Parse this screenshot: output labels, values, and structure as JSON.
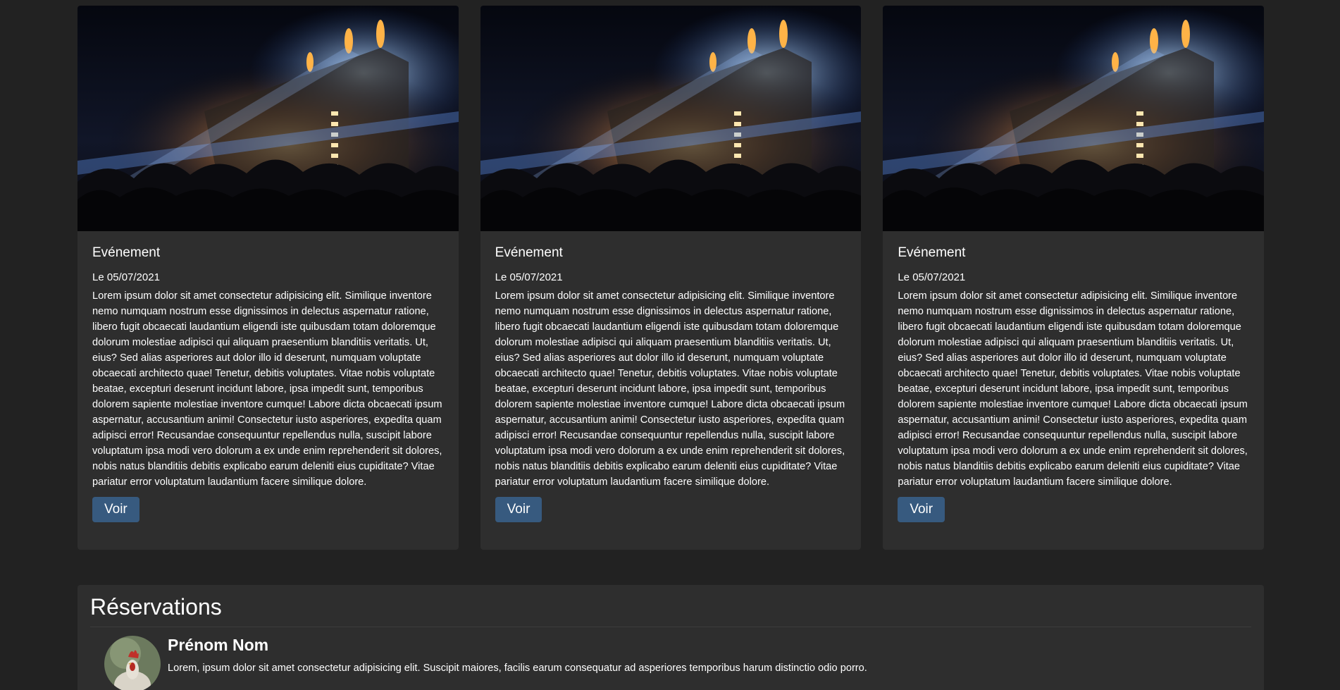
{
  "events": [
    {
      "title": "Evénement",
      "date": "Le 05/07/2021",
      "text": "Lorem ipsum dolor sit amet consectetur adipisicing elit. Similique inventore nemo numquam nostrum esse dignissimos in delectus aspernatur ratione, libero fugit obcaecati laudantium eligendi iste quibusdam totam doloremque dolorum molestiae adipisci qui aliquam praesentium blanditiis veritatis. Ut, eius? Sed alias asperiores aut dolor illo id deserunt, numquam voluptate obcaecati architecto quae! Tenetur, debitis voluptates. Vitae nobis voluptate beatae, excepturi deserunt incidunt labore, ipsa impedit sunt, temporibus dolorem sapiente molestiae inventore cumque! Labore dicta obcaecati ipsum aspernatur, accusantium animi! Consectetur iusto asperiores, expedita quam adipisci error! Recusandae consequuntur repellendus nulla, suscipit labore voluptatum ipsa modi vero dolorum a ex unde enim reprehenderit sit dolores, nobis natus blanditiis debitis explicabo earum deleniti eius cupiditate? Vitae pariatur error voluptatum laudantium facere similique dolore.",
      "button": "Voir"
    },
    {
      "title": "Evénement",
      "date": "Le 05/07/2021",
      "text": "Lorem ipsum dolor sit amet consectetur adipisicing elit. Similique inventore nemo numquam nostrum esse dignissimos in delectus aspernatur ratione, libero fugit obcaecati laudantium eligendi iste quibusdam totam doloremque dolorum molestiae adipisci qui aliquam praesentium blanditiis veritatis. Ut, eius? Sed alias asperiores aut dolor illo id deserunt, numquam voluptate obcaecati architecto quae! Tenetur, debitis voluptates. Vitae nobis voluptate beatae, excepturi deserunt incidunt labore, ipsa impedit sunt, temporibus dolorem sapiente molestiae inventore cumque! Labore dicta obcaecati ipsum aspernatur, accusantium animi! Consectetur iusto asperiores, expedita quam adipisci error! Recusandae consequuntur repellendus nulla, suscipit labore voluptatum ipsa modi vero dolorum a ex unde enim reprehenderit sit dolores, nobis natus blanditiis debitis explicabo earum deleniti eius cupiditate? Vitae pariatur error voluptatum laudantium facere similique dolore.",
      "button": "Voir"
    },
    {
      "title": "Evénement",
      "date": "Le 05/07/2021",
      "text": "Lorem ipsum dolor sit amet consectetur adipisicing elit. Similique inventore nemo numquam nostrum esse dignissimos in delectus aspernatur ratione, libero fugit obcaecati laudantium eligendi iste quibusdam totam doloremque dolorum molestiae adipisci qui aliquam praesentium blanditiis veritatis. Ut, eius? Sed alias asperiores aut dolor illo id deserunt, numquam voluptate obcaecati architecto quae! Tenetur, debitis voluptates. Vitae nobis voluptate beatae, excepturi deserunt incidunt labore, ipsa impedit sunt, temporibus dolorem sapiente molestiae inventore cumque! Labore dicta obcaecati ipsum aspernatur, accusantium animi! Consectetur iusto asperiores, expedita quam adipisci error! Recusandae consequuntur repellendus nulla, suscipit labore voluptatum ipsa modi vero dolorum a ex unde enim reprehenderit sit dolores, nobis natus blanditiis debitis explicabo earum deleniti eius cupiditate? Vitae pariatur error voluptatum laudantium facere similique dolore.",
      "button": "Voir"
    }
  ],
  "reservations": {
    "title": "Réservations",
    "items": [
      {
        "name": "Prénom Nom",
        "text": "Lorem, ipsum dolor sit amet consectetur adipisicing elit. Suscipit maiores, facilis earum consequatur ad asperiores temporibus harum distinctio odio porro."
      }
    ]
  },
  "colors": {
    "background": "#222222",
    "card": "#2e2e2e",
    "button": "#375a7f"
  }
}
